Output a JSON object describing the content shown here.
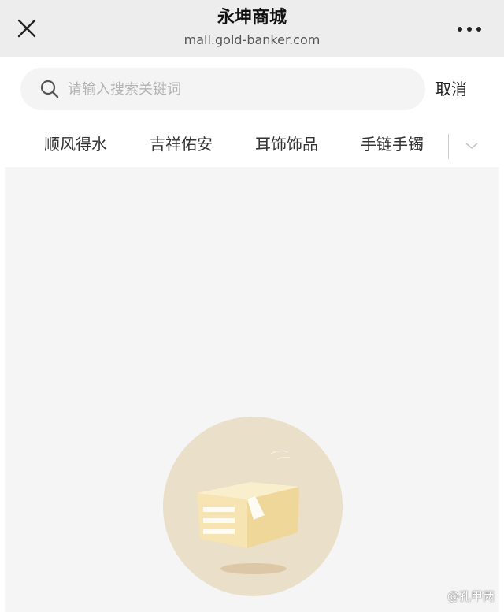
{
  "header": {
    "title": "永坤商城",
    "url": "mall.gold-banker.com",
    "close_icon": "close-icon",
    "more_icon": "more-dots-icon"
  },
  "search": {
    "placeholder": "请输入搜索关键词",
    "value": "",
    "cancel_label": "取消",
    "icon": "search-icon"
  },
  "tabs": [
    {
      "label": "顺风得水"
    },
    {
      "label": "吉祥佑安"
    },
    {
      "label": "耳饰饰品"
    },
    {
      "label": "手链手镯"
    }
  ],
  "tabs_expand_icon": "chevron-down-icon",
  "watermark": "@孔甲两",
  "colors": {
    "titlebar_bg": "#ededed",
    "search_bg": "#f4f4f4",
    "content_bg": "#f5f5f5",
    "illustration_circle": "#eadfc8",
    "illustration_box": "#f7e9bd"
  }
}
